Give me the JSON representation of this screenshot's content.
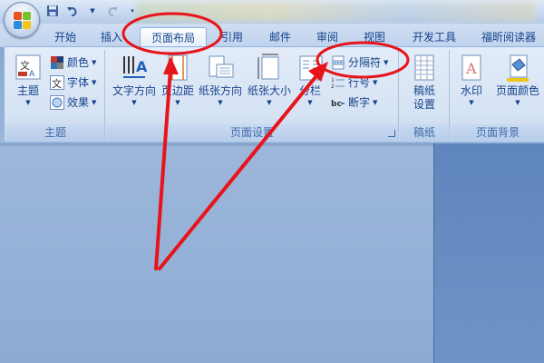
{
  "quick_access": {
    "undo_icon": "undo-icon",
    "redo_icon": "redo-icon",
    "save_icon": "save-icon"
  },
  "tabs": [
    {
      "label": "开始",
      "active": false
    },
    {
      "label": "插入",
      "active": false
    },
    {
      "label": "页面布局",
      "active": true
    },
    {
      "label": "引用",
      "active": false
    },
    {
      "label": "邮件",
      "active": false
    },
    {
      "label": "审阅",
      "active": false
    },
    {
      "label": "视图",
      "active": false
    },
    {
      "label": "开发工具",
      "active": false
    },
    {
      "label": "福昕阅读器",
      "active": false
    }
  ],
  "groups": {
    "theme": {
      "label": "主题",
      "theme_button": "主题",
      "colors": "颜色",
      "fonts": "字体",
      "effects": "效果"
    },
    "page_setup": {
      "label": "页面设置",
      "text_direction": "文字方向",
      "margins": "页边距",
      "orientation": "纸张方向",
      "size": "纸张大小",
      "columns": "分栏",
      "breaks": "分隔符",
      "line_numbers": "行号",
      "hyphenation": "断字"
    },
    "manuscript": {
      "label": "稿纸",
      "button_line1": "稿纸",
      "button_line2": "设置"
    },
    "page_background": {
      "label": "页面背景",
      "watermark": "水印",
      "page_color": "页面颜色"
    }
  },
  "colors": {
    "annotation": "#e8141b",
    "ribbon_text": "#15428b",
    "group_label": "#3e6aaa"
  }
}
